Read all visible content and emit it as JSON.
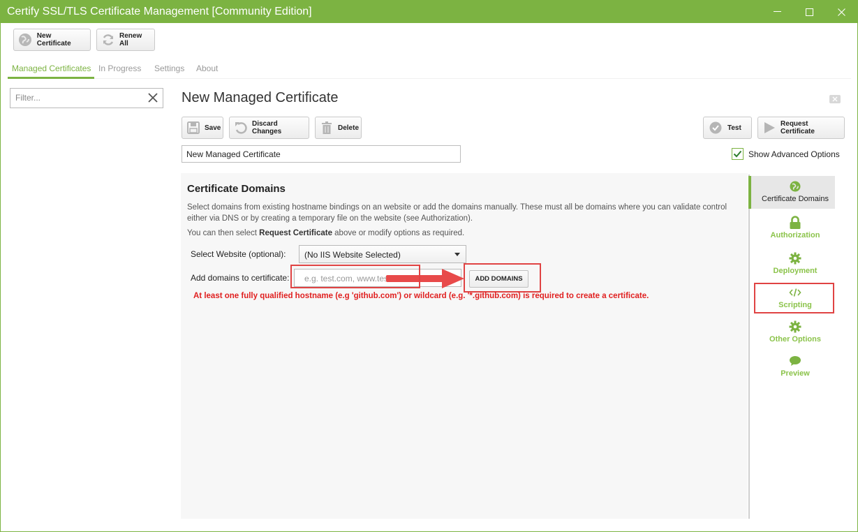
{
  "window": {
    "title": "Certify SSL/TLS Certificate Management [Community Edition]",
    "controls": {
      "minimize": "—",
      "maximize": "☐",
      "close": "✕"
    }
  },
  "toolbar": {
    "new_certificate": "New Certificate",
    "renew_all": "Renew All"
  },
  "tabs": [
    {
      "label": "Managed Certificates",
      "active": true
    },
    {
      "label": "In Progress",
      "active": false
    },
    {
      "label": "Settings",
      "active": false
    },
    {
      "label": "About",
      "active": false
    }
  ],
  "filter": {
    "placeholder": "Filter..."
  },
  "editor": {
    "title": "New Managed Certificate",
    "buttons": {
      "save": "Save",
      "discard": "Discard Changes",
      "delete": "Delete",
      "test": "Test",
      "request": "Request Certificate"
    },
    "name_value": "New Managed Certificate",
    "show_advanced_label": "Show Advanced Options",
    "show_advanced_checked": true
  },
  "domains": {
    "heading": "Certificate Domains",
    "description": "Select domains from existing hostname bindings on an website or add the domains manually. These must all be domains where you can validate control either via DNS or by creating a temporary file on the website (see Authorization).",
    "hint_prefix": "You can then select ",
    "hint_bold": "Request Certificate",
    "hint_suffix": " above or modify options as required.",
    "select_label": "Select Website (optional):",
    "select_value": "(No IIS Website Selected)",
    "add_label": "Add domains to certificate:",
    "add_placeholder": "e.g. test.com, www.test.com",
    "add_button": "ADD DOMAINS",
    "error": "At least one fully qualified hostname (e.g 'github.com') or wildcard (e.g. '*.github.com) is required to create a certificate."
  },
  "side_nav": [
    {
      "label": "Certificate Domains",
      "icon": "globe-icon",
      "active": true
    },
    {
      "label": "Authorization",
      "icon": "lock-icon",
      "active": false
    },
    {
      "label": "Deployment",
      "icon": "gear-icon",
      "active": false
    },
    {
      "label": "Scripting",
      "icon": "code-icon",
      "active": false
    },
    {
      "label": "Other Options",
      "icon": "gear-icon",
      "active": false
    },
    {
      "label": "Preview",
      "icon": "comment-icon",
      "active": false
    }
  ],
  "colors": {
    "accent": "#7cb342",
    "error": "#e02020",
    "highlight": "#e04343"
  }
}
